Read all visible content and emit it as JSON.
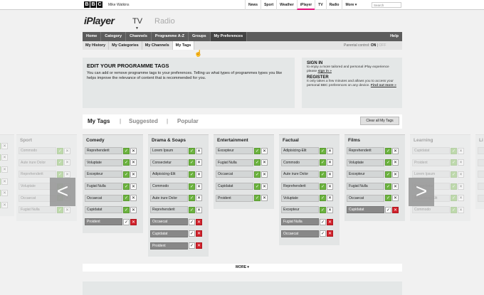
{
  "bbc_bar": {
    "logo": [
      "B",
      "B",
      "C"
    ],
    "user_name": "Mike Watkins",
    "nav": [
      "News",
      "Sport",
      "Weather",
      "iPlayer",
      "TV",
      "Radio",
      "More ▾"
    ],
    "active_nav": "iPlayer",
    "search_placeholder": "Search"
  },
  "header": {
    "logo": "iPlayer",
    "tv": "TV",
    "radio": "Radio"
  },
  "main_nav": {
    "items": [
      "Home",
      "Category",
      "Channels",
      "Programme A-Z",
      "Groups",
      "My Preferences"
    ],
    "active": "My Preferences",
    "help": "Help"
  },
  "sub_nav": {
    "items": [
      "My History",
      "My Categories",
      "My Channels",
      "My Tags"
    ],
    "active": "My Tags",
    "parental_label": "Parental control:",
    "parental_on": "ON",
    "parental_off": "OFF"
  },
  "edit_box": {
    "title": "EDIT YOUR PROGRAMME TAGS",
    "description": "You can add or remove programme tags to your preferences. Telling us what types of programmes types you like helps improve the relevance of content that is recommended for you."
  },
  "sign_box": {
    "sign_in_title": "SIGN IN",
    "sign_in_text": "to enjoy a more tailored and personal iPlay experience please",
    "sign_in_link": "sign in »",
    "register_title": "REGISTER",
    "register_text": "It only takes a few minutes and allows you to access your personal BBC preferences on any device.",
    "register_link": "Find out more »"
  },
  "tabs": {
    "my_tags": "My Tags",
    "separator": "|",
    "suggested": "Suggested",
    "popular": "Popular",
    "clear_all": "Clear all My Tags"
  },
  "categories": [
    {
      "title": "",
      "faded": true,
      "tags": [
        {
          "name": "",
          "state": "on"
        },
        {
          "name": "",
          "state": "on"
        },
        {
          "name": "",
          "state": "on"
        },
        {
          "name": "",
          "state": "on"
        },
        {
          "name": "",
          "state": "on"
        },
        {
          "name": "",
          "state": "on"
        }
      ]
    },
    {
      "title": "Sport",
      "faded": true,
      "tags": [
        {
          "name": "Commodo",
          "state": "on"
        },
        {
          "name": "Aute irure Dolor",
          "state": "on"
        },
        {
          "name": "Reprehenderit",
          "state": "on"
        },
        {
          "name": "Voluptate",
          "state": "on"
        },
        {
          "name": "Occaecat",
          "state": "on"
        },
        {
          "name": "Fugiat Nulla",
          "state": "on"
        }
      ]
    },
    {
      "title": "Comedy",
      "faded": false,
      "tags": [
        {
          "name": "Reprehenderit",
          "state": "on"
        },
        {
          "name": "Voluptate",
          "state": "on"
        },
        {
          "name": "Excepteur",
          "state": "on"
        },
        {
          "name": "Fugiat Nulla",
          "state": "on"
        },
        {
          "name": "Occaecat",
          "state": "on"
        },
        {
          "name": "Cupidatat",
          "state": "on"
        },
        {
          "name": "Proident",
          "state": "off"
        }
      ]
    },
    {
      "title": "Drama & Soaps",
      "faded": false,
      "tags": [
        {
          "name": "Lorem Ipsum",
          "state": "on"
        },
        {
          "name": "Consectetur",
          "state": "on"
        },
        {
          "name": "Adipisicing-Elit",
          "state": "on"
        },
        {
          "name": "Commodo",
          "state": "on"
        },
        {
          "name": "Aute irure Dolor",
          "state": "on"
        },
        {
          "name": "Reprehenderit",
          "state": "on"
        },
        {
          "name": "Occaecat",
          "state": "off"
        },
        {
          "name": "Cupidatat",
          "state": "off"
        },
        {
          "name": "Proident",
          "state": "off"
        }
      ]
    },
    {
      "title": "Entertainment",
      "faded": false,
      "tags": [
        {
          "name": "Excepteur",
          "state": "on"
        },
        {
          "name": "Fugiat Nulla",
          "state": "on"
        },
        {
          "name": "Occaecat",
          "state": "on"
        },
        {
          "name": "Cupidatat",
          "state": "on"
        },
        {
          "name": "Proident",
          "state": "on"
        }
      ]
    },
    {
      "title": "Factual",
      "faded": false,
      "tags": [
        {
          "name": "Adipisicing-Elit",
          "state": "on"
        },
        {
          "name": "Commodo",
          "state": "on"
        },
        {
          "name": "Aute irure Dolor",
          "state": "on"
        },
        {
          "name": "Reprehenderit",
          "state": "on"
        },
        {
          "name": "Voluptate",
          "state": "on"
        },
        {
          "name": "Excepteur",
          "state": "on"
        },
        {
          "name": "Fugiat Nulla",
          "state": "off"
        },
        {
          "name": "Occaecat",
          "state": "off"
        }
      ]
    },
    {
      "title": "Films",
      "faded": false,
      "tags": [
        {
          "name": "Reprehenderit",
          "state": "on"
        },
        {
          "name": "Voluptate",
          "state": "on"
        },
        {
          "name": "Excepteur",
          "state": "on"
        },
        {
          "name": "Fugiat Nulla",
          "state": "on"
        },
        {
          "name": "Occaecat",
          "state": "on"
        },
        {
          "name": "Cupidatat",
          "state": "off"
        }
      ]
    },
    {
      "title": "Learning",
      "faded": true,
      "tags": [
        {
          "name": "Cupidatat",
          "state": "on"
        },
        {
          "name": "Proident",
          "state": "on"
        },
        {
          "name": "Lorem Ipsum",
          "state": "on"
        },
        {
          "name": "Consectetur",
          "state": "on"
        },
        {
          "name": "Adipisicing-Elit",
          "state": "on"
        },
        {
          "name": "Commodo",
          "state": "on"
        }
      ]
    },
    {
      "title": "Li",
      "faded": true,
      "tags": [
        {
          "name": "",
          "state": "on"
        },
        {
          "name": "",
          "state": "on"
        },
        {
          "name": "",
          "state": "on"
        },
        {
          "name": "",
          "state": "on"
        },
        {
          "name": "",
          "state": "on"
        }
      ]
    }
  ],
  "arrows": {
    "left": "<",
    "right": ">"
  },
  "more_button": "MORE ▾",
  "colors": {
    "check_green": "#6cb33f",
    "remove_red": "#d0202a",
    "nav_dark": "#5c5c5c",
    "accent_pink": "#e3127e"
  }
}
